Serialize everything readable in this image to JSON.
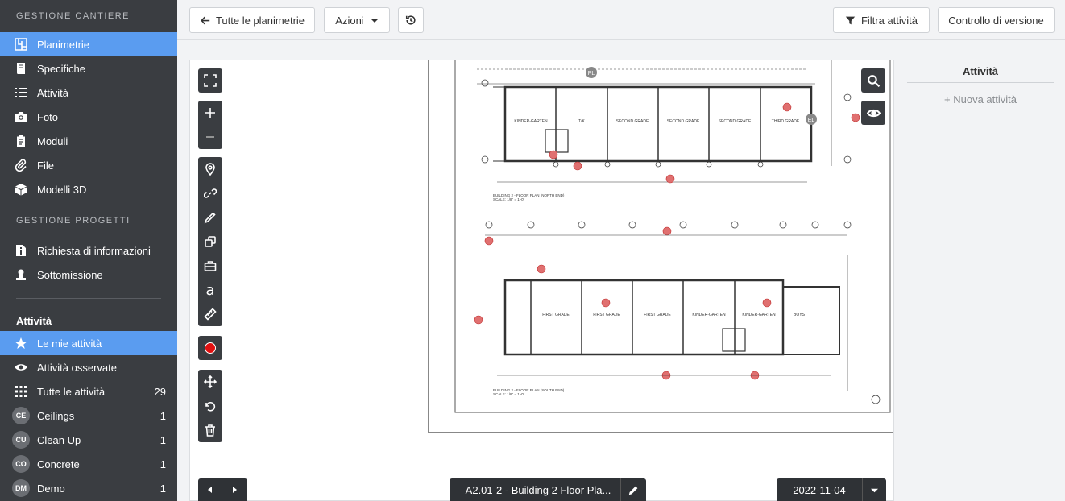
{
  "sidebar": {
    "section1": "GESTIONE CANTIERE",
    "items1": [
      {
        "label": "Planimetrie",
        "icon": "floorplan-icon",
        "active": true
      },
      {
        "label": "Specifiche",
        "icon": "book-icon"
      },
      {
        "label": "Attività",
        "icon": "list-icon"
      },
      {
        "label": "Foto",
        "icon": "camera-icon"
      },
      {
        "label": "Moduli",
        "icon": "clipboard-icon"
      },
      {
        "label": "File",
        "icon": "paperclip-icon"
      },
      {
        "label": "Modelli 3D",
        "icon": "cube-icon"
      }
    ],
    "section2": "GESTIONE PROGETTI",
    "items2": [
      {
        "label": "Richiesta di informazioni",
        "icon": "info-file-icon"
      },
      {
        "label": "Sottomissione",
        "icon": "user-stamp-icon"
      }
    ],
    "tasks_heading": "Attività",
    "task_items": [
      {
        "label": "Le mie attività",
        "icon": "star-icon",
        "active": true,
        "count": ""
      },
      {
        "label": "Attività osservate",
        "icon": "eye-icon",
        "count": ""
      },
      {
        "label": "Tutte le attività",
        "icon": "grid-icon",
        "count": "29"
      }
    ],
    "categories": [
      {
        "badge": "CE",
        "label": "Ceilings",
        "count": "1"
      },
      {
        "badge": "CU",
        "label": "Clean Up",
        "count": "1"
      },
      {
        "badge": "CO",
        "label": "Concrete",
        "count": "1"
      },
      {
        "badge": "DM",
        "label": "Demo",
        "count": "1"
      }
    ]
  },
  "toolbar": {
    "back_label": "Tutte le planimetrie",
    "actions_label": "Azioni",
    "filter_label": "Filtra attività",
    "version_label": "Controllo di versione"
  },
  "right_panel": {
    "title": "Attività",
    "new_task": "+ Nuova attività"
  },
  "drawing": {
    "north_title": "BUILDING 2 - FLOOR PLAN (NORTH END)",
    "south_title": "BUILDING 2 - FLOOR PLAN (SOUTH END)",
    "scale": "SCALE: 1/8\" = 1'-0\"",
    "north_rooms": [
      "KINDER-GARTEN",
      "T/K",
      "SECOND GRADE",
      "SECOND GRADE",
      "SECOND GRADE",
      "THIRD GRADE"
    ],
    "south_rooms": [
      "FIRST GRADE",
      "FIRST GRADE",
      "FIRST GRADE",
      "KINDER-GARTEN",
      "KINDER-GARTEN",
      "BOYS"
    ]
  },
  "bottom": {
    "sheet_label": "A2.01-2 - Building 2 Floor Pla...",
    "date_label": "2022-11-04"
  },
  "colors": {
    "accent": "#5a9cf0",
    "sidebar_bg": "#3a3d41",
    "record": "#e01010"
  }
}
